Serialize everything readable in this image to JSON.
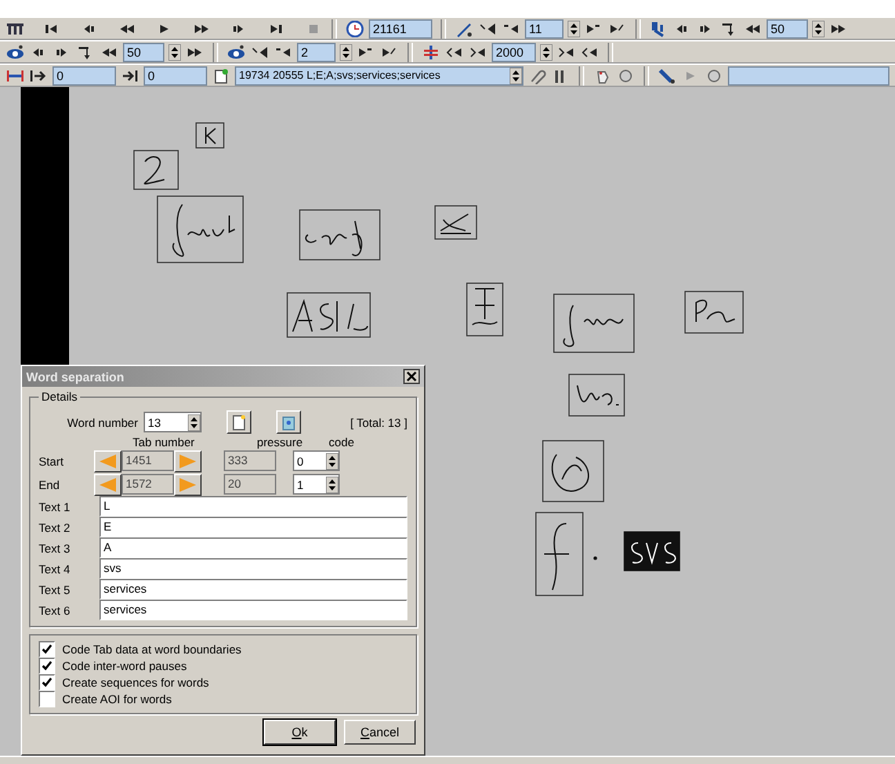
{
  "toolbar_1": {
    "time_field": "21161",
    "spin_1": "11",
    "spin_2": "50"
  },
  "toolbar_2": {
    "spin_1": "50",
    "spin_2": "2",
    "spin_3": "2000"
  },
  "toolbar_3": {
    "start_field": "0",
    "end_field": "0",
    "sequence_combo": "19734 20555 L;E;A;svs;services;services"
  },
  "dialog": {
    "title": "Word separation",
    "group": "Details",
    "word_number_label": "Word number",
    "word_number": "13",
    "total": "[ Total: 13 ]",
    "columns": [
      "Tab number",
      "pressure",
      "code"
    ],
    "rows": [
      {
        "label": "Start",
        "tab": "1451",
        "pressure": "333",
        "code": "0"
      },
      {
        "label": "End",
        "tab": "1572",
        "pressure": "20",
        "code": "1"
      }
    ],
    "texts": [
      {
        "label": "Text 1",
        "value": "L"
      },
      {
        "label": "Text 2",
        "value": "E"
      },
      {
        "label": "Text 3",
        "value": "A"
      },
      {
        "label": "Text 4",
        "value": "svs"
      },
      {
        "label": "Text 5",
        "value": "services"
      },
      {
        "label": "Text 6",
        "value": "services"
      }
    ],
    "options": [
      {
        "label": "Code Tab data at word boundaries",
        "checked": true
      },
      {
        "label": "Code inter-word pauses",
        "checked": true
      },
      {
        "label": "Create sequences for words",
        "checked": true
      },
      {
        "label": "Create AOI for words",
        "checked": false
      }
    ],
    "buttons": [
      "Ok",
      "Cancel"
    ]
  }
}
